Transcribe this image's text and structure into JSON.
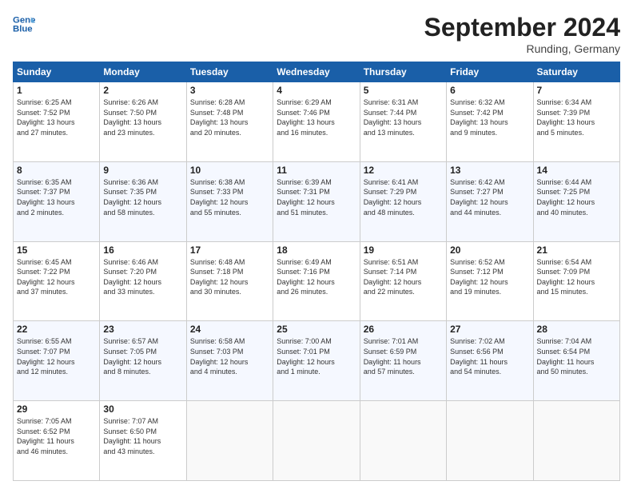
{
  "header": {
    "logo_line1": "General",
    "logo_line2": "Blue",
    "month_title": "September 2024",
    "location": "Runding, Germany"
  },
  "weekdays": [
    "Sunday",
    "Monday",
    "Tuesday",
    "Wednesday",
    "Thursday",
    "Friday",
    "Saturday"
  ],
  "weeks": [
    [
      {
        "day": "1",
        "lines": [
          "Sunrise: 6:25 AM",
          "Sunset: 7:52 PM",
          "Daylight: 13 hours",
          "and 27 minutes."
        ]
      },
      {
        "day": "2",
        "lines": [
          "Sunrise: 6:26 AM",
          "Sunset: 7:50 PM",
          "Daylight: 13 hours",
          "and 23 minutes."
        ]
      },
      {
        "day": "3",
        "lines": [
          "Sunrise: 6:28 AM",
          "Sunset: 7:48 PM",
          "Daylight: 13 hours",
          "and 20 minutes."
        ]
      },
      {
        "day": "4",
        "lines": [
          "Sunrise: 6:29 AM",
          "Sunset: 7:46 PM",
          "Daylight: 13 hours",
          "and 16 minutes."
        ]
      },
      {
        "day": "5",
        "lines": [
          "Sunrise: 6:31 AM",
          "Sunset: 7:44 PM",
          "Daylight: 13 hours",
          "and 13 minutes."
        ]
      },
      {
        "day": "6",
        "lines": [
          "Sunrise: 6:32 AM",
          "Sunset: 7:42 PM",
          "Daylight: 13 hours",
          "and 9 minutes."
        ]
      },
      {
        "day": "7",
        "lines": [
          "Sunrise: 6:34 AM",
          "Sunset: 7:39 PM",
          "Daylight: 13 hours",
          "and 5 minutes."
        ]
      }
    ],
    [
      {
        "day": "8",
        "lines": [
          "Sunrise: 6:35 AM",
          "Sunset: 7:37 PM",
          "Daylight: 13 hours",
          "and 2 minutes."
        ]
      },
      {
        "day": "9",
        "lines": [
          "Sunrise: 6:36 AM",
          "Sunset: 7:35 PM",
          "Daylight: 12 hours",
          "and 58 minutes."
        ]
      },
      {
        "day": "10",
        "lines": [
          "Sunrise: 6:38 AM",
          "Sunset: 7:33 PM",
          "Daylight: 12 hours",
          "and 55 minutes."
        ]
      },
      {
        "day": "11",
        "lines": [
          "Sunrise: 6:39 AM",
          "Sunset: 7:31 PM",
          "Daylight: 12 hours",
          "and 51 minutes."
        ]
      },
      {
        "day": "12",
        "lines": [
          "Sunrise: 6:41 AM",
          "Sunset: 7:29 PM",
          "Daylight: 12 hours",
          "and 48 minutes."
        ]
      },
      {
        "day": "13",
        "lines": [
          "Sunrise: 6:42 AM",
          "Sunset: 7:27 PM",
          "Daylight: 12 hours",
          "and 44 minutes."
        ]
      },
      {
        "day": "14",
        "lines": [
          "Sunrise: 6:44 AM",
          "Sunset: 7:25 PM",
          "Daylight: 12 hours",
          "and 40 minutes."
        ]
      }
    ],
    [
      {
        "day": "15",
        "lines": [
          "Sunrise: 6:45 AM",
          "Sunset: 7:22 PM",
          "Daylight: 12 hours",
          "and 37 minutes."
        ]
      },
      {
        "day": "16",
        "lines": [
          "Sunrise: 6:46 AM",
          "Sunset: 7:20 PM",
          "Daylight: 12 hours",
          "and 33 minutes."
        ]
      },
      {
        "day": "17",
        "lines": [
          "Sunrise: 6:48 AM",
          "Sunset: 7:18 PM",
          "Daylight: 12 hours",
          "and 30 minutes."
        ]
      },
      {
        "day": "18",
        "lines": [
          "Sunrise: 6:49 AM",
          "Sunset: 7:16 PM",
          "Daylight: 12 hours",
          "and 26 minutes."
        ]
      },
      {
        "day": "19",
        "lines": [
          "Sunrise: 6:51 AM",
          "Sunset: 7:14 PM",
          "Daylight: 12 hours",
          "and 22 minutes."
        ]
      },
      {
        "day": "20",
        "lines": [
          "Sunrise: 6:52 AM",
          "Sunset: 7:12 PM",
          "Daylight: 12 hours",
          "and 19 minutes."
        ]
      },
      {
        "day": "21",
        "lines": [
          "Sunrise: 6:54 AM",
          "Sunset: 7:09 PM",
          "Daylight: 12 hours",
          "and 15 minutes."
        ]
      }
    ],
    [
      {
        "day": "22",
        "lines": [
          "Sunrise: 6:55 AM",
          "Sunset: 7:07 PM",
          "Daylight: 12 hours",
          "and 12 minutes."
        ]
      },
      {
        "day": "23",
        "lines": [
          "Sunrise: 6:57 AM",
          "Sunset: 7:05 PM",
          "Daylight: 12 hours",
          "and 8 minutes."
        ]
      },
      {
        "day": "24",
        "lines": [
          "Sunrise: 6:58 AM",
          "Sunset: 7:03 PM",
          "Daylight: 12 hours",
          "and 4 minutes."
        ]
      },
      {
        "day": "25",
        "lines": [
          "Sunrise: 7:00 AM",
          "Sunset: 7:01 PM",
          "Daylight: 12 hours",
          "and 1 minute."
        ]
      },
      {
        "day": "26",
        "lines": [
          "Sunrise: 7:01 AM",
          "Sunset: 6:59 PM",
          "Daylight: 11 hours",
          "and 57 minutes."
        ]
      },
      {
        "day": "27",
        "lines": [
          "Sunrise: 7:02 AM",
          "Sunset: 6:56 PM",
          "Daylight: 11 hours",
          "and 54 minutes."
        ]
      },
      {
        "day": "28",
        "lines": [
          "Sunrise: 7:04 AM",
          "Sunset: 6:54 PM",
          "Daylight: 11 hours",
          "and 50 minutes."
        ]
      }
    ],
    [
      {
        "day": "29",
        "lines": [
          "Sunrise: 7:05 AM",
          "Sunset: 6:52 PM",
          "Daylight: 11 hours",
          "and 46 minutes."
        ]
      },
      {
        "day": "30",
        "lines": [
          "Sunrise: 7:07 AM",
          "Sunset: 6:50 PM",
          "Daylight: 11 hours",
          "and 43 minutes."
        ]
      },
      {
        "day": "",
        "lines": []
      },
      {
        "day": "",
        "lines": []
      },
      {
        "day": "",
        "lines": []
      },
      {
        "day": "",
        "lines": []
      },
      {
        "day": "",
        "lines": []
      }
    ]
  ]
}
